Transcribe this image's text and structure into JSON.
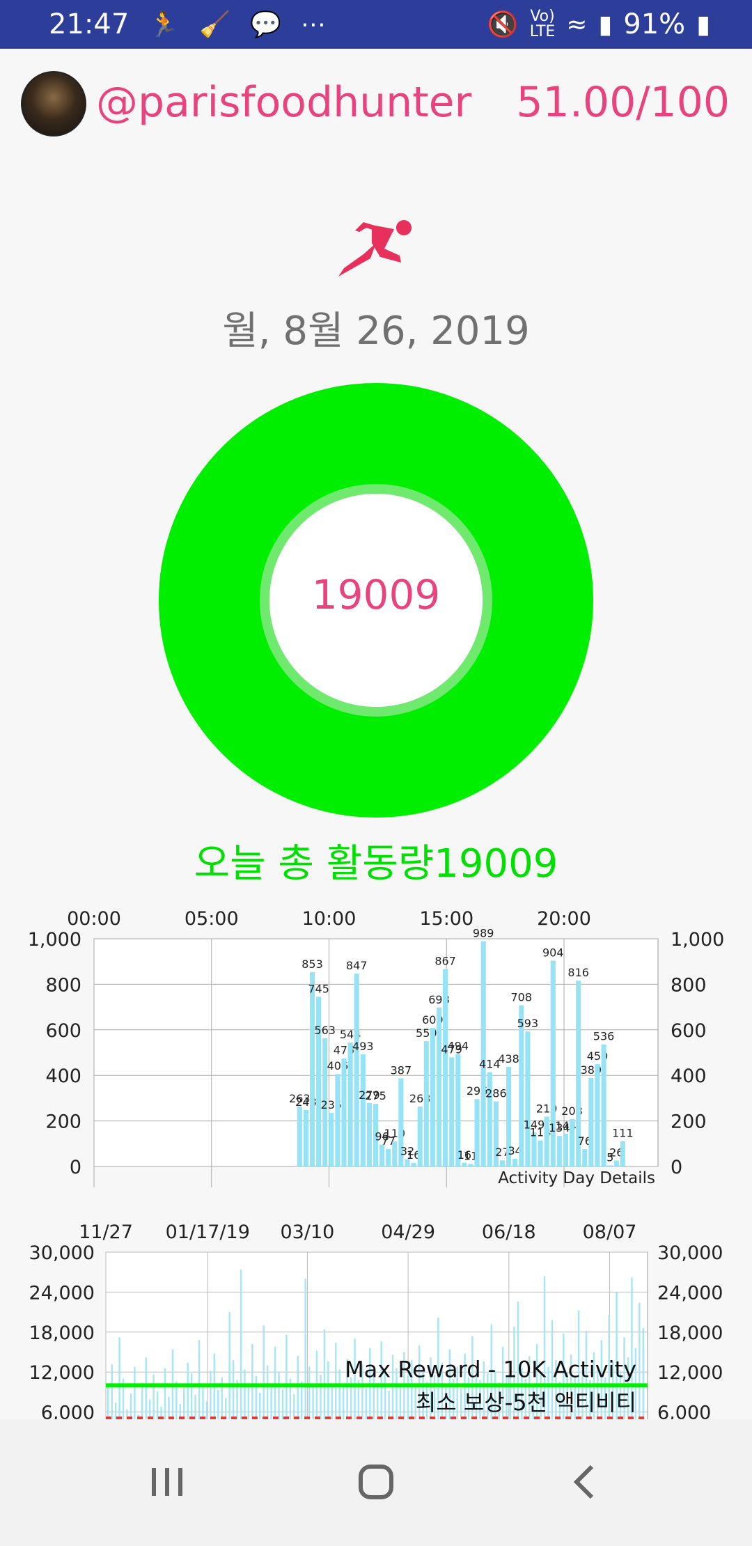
{
  "status": {
    "time": "21:47",
    "battery": "91%",
    "left_icons": [
      "runner-icon",
      "cleaner-icon",
      "chat-icon",
      "more-icon"
    ],
    "right_icons": [
      "mute-icon",
      "volte-icon",
      "wifi-icon",
      "signal-icon",
      "battery-icon"
    ]
  },
  "header": {
    "username": "@parisfoodhunter",
    "score": "51.00/100"
  },
  "date": "월, 8월 26, 2019",
  "donut": {
    "value": "19009",
    "fill_fraction": 1.0
  },
  "today_label": "오늘 총 활동량19009",
  "colors": {
    "accent": "#e8437e",
    "green": "#00ee00",
    "bar": "#96e3f5",
    "status_bar": "#2d3e9a"
  },
  "chart_data": [
    {
      "type": "bar",
      "title": "Activity Day Details",
      "x_tick_labels": [
        "00:00",
        "05:00",
        "10:00",
        "15:00",
        "20:00"
      ],
      "y_tick_labels": [
        "0",
        "200",
        "400",
        "600",
        "800",
        "1,000"
      ],
      "ylim": [
        0,
        1000
      ],
      "xlim": [
        0,
        24
      ],
      "x": [
        8.75,
        9.0,
        9.25,
        9.5,
        9.75,
        10.0,
        10.25,
        10.5,
        10.75,
        11.0,
        11.25,
        11.5,
        11.75,
        12.0,
        12.25,
        12.5,
        12.75,
        13.0,
        13.25,
        13.5,
        13.75,
        14.0,
        14.25,
        14.5,
        14.75,
        15.0,
        15.25,
        15.5,
        15.75,
        16.0,
        16.25,
        16.5,
        16.75,
        17.0,
        17.25,
        17.5,
        17.75,
        18.0,
        18.25,
        18.5,
        18.75,
        19.0,
        19.25,
        19.5,
        19.75,
        20.0,
        20.25,
        20.5,
        20.75,
        21.0,
        21.25,
        21.5,
        21.75,
        22.0,
        22.25,
        22.5
      ],
      "values": [
        263,
        248,
        853,
        745,
        563,
        235,
        406,
        475,
        544,
        847,
        493,
        279,
        275,
        96,
        77,
        110,
        387,
        32,
        16,
        263,
        550,
        609,
        698,
        867,
        479,
        494,
        16,
        11,
        296,
        989,
        414,
        286,
        27,
        438,
        34,
        708,
        593,
        149,
        114,
        219,
        904,
        134,
        144,
        208,
        816,
        76,
        389,
        450,
        536,
        5,
        26,
        111
      ],
      "labels": [
        "263",
        "248",
        "853",
        "745",
        "563",
        "235",
        "406",
        "475",
        "544",
        "847",
        "493",
        "279",
        "275",
        "96",
        "77",
        "110",
        "387",
        "32",
        "16",
        "263",
        "550",
        "609",
        "698",
        "867",
        "479",
        "494",
        "16",
        "11",
        "296",
        "989",
        "414",
        "286",
        "27",
        "438",
        "34",
        "708",
        "593",
        "149",
        "114",
        "219",
        "904",
        "134",
        "144",
        "208",
        "816",
        "76",
        "389",
        "450",
        "536",
        "5",
        "26",
        "111"
      ],
      "grid": true,
      "legend": "none"
    },
    {
      "type": "bar",
      "x_tick_labels": [
        "11/27",
        "01/17/19",
        "03/10",
        "04/29",
        "06/18",
        "08/07"
      ],
      "y_tick_labels": [
        "6,000",
        "12,000",
        "18,000",
        "24,000",
        "30,000"
      ],
      "ylim": [
        0,
        30000
      ],
      "reference_lines": [
        {
          "label": "Max Reward - 10K Activity",
          "value": 10000,
          "color": "#00ee00",
          "style": "solid"
        },
        {
          "label": "최소 보상-5천 액티비티",
          "value": 5000,
          "color": "#e53935",
          "style": "dotted"
        }
      ],
      "values": [
        9800,
        13200,
        7400,
        17200,
        11000,
        6400,
        8800,
        12800,
        5600,
        10400,
        14200,
        7900,
        11600,
        9100,
        6800,
        12600,
        8300,
        15400,
        10600,
        7200,
        9600,
        13400,
        11800,
        8600,
        16800,
        10200,
        7600,
        12200,
        14800,
        9300,
        11200,
        8100,
        21000,
        13800,
        10800,
        27400,
        12400,
        9800,
        16200,
        11400,
        8900,
        19000,
        13000,
        10300,
        15800,
        12000,
        9400,
        17600,
        11000,
        8700,
        14400,
        10600,
        26000,
        12800,
        9900,
        15200,
        11600,
        18400,
        13600,
        10100,
        16400,
        12400,
        9700,
        14000,
        11200,
        17000,
        10800,
        13200,
        9500,
        15600,
        12200,
        10400,
        16600,
        11800,
        9200,
        14600,
        12600,
        10000,
        15000,
        11400,
        13800,
        9900,
        16000,
        12000,
        10600,
        14200,
        11600,
        20200,
        13400,
        10200,
        15400,
        11000,
        12800,
        9600,
        14800,
        11200,
        17400,
        12400,
        10800,
        13600,
        11800,
        19200,
        12200,
        10400,
        15800,
        11400,
        13000,
        18800,
        22600,
        12600,
        11000,
        14400,
        10200,
        16200,
        11600,
        26400,
        12800,
        19800,
        13800,
        10600,
        17800,
        12000,
        14600,
        11400,
        21200,
        13200,
        18200,
        10800,
        15000,
        12400,
        16800,
        11200,
        20600,
        13600,
        24000,
        12200,
        17200,
        14200,
        26200,
        15600,
        22400,
        18600
      ],
      "grid": true,
      "legend": "none"
    }
  ],
  "nav": {
    "icons": [
      "recent-apps-icon",
      "home-icon",
      "back-icon"
    ]
  }
}
